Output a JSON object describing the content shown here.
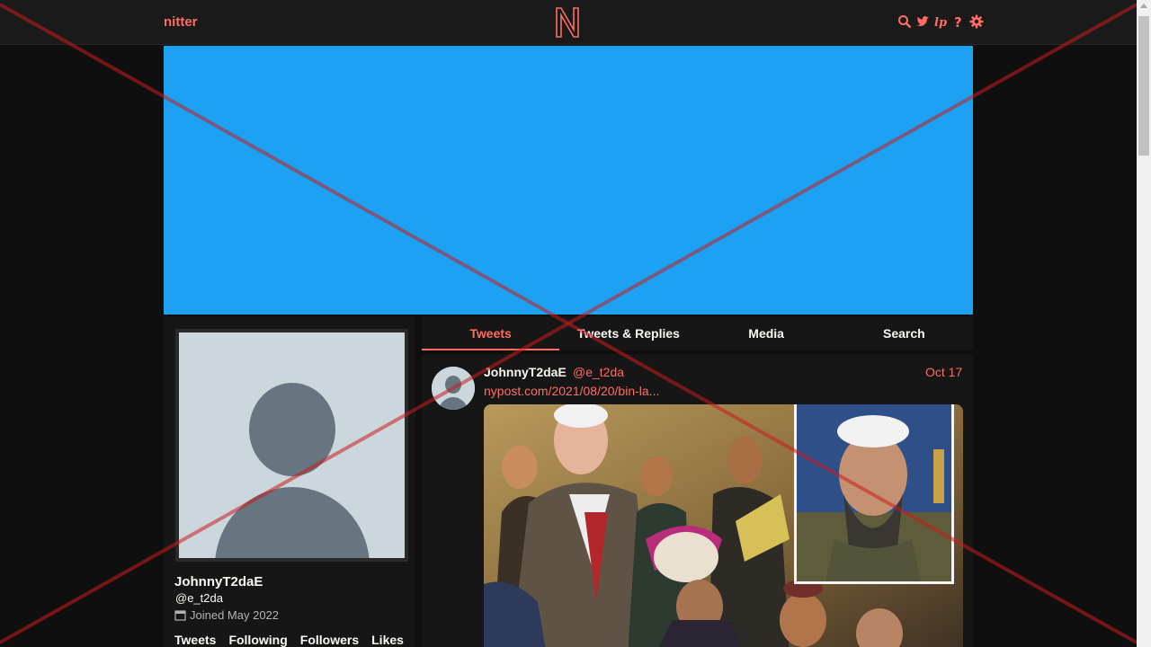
{
  "nav": {
    "brand": "nitter",
    "logo_letter": "N",
    "icons": [
      "search-icon",
      "twitter-bird-icon",
      "liberapay-icon",
      "help-icon",
      "settings-gear-icon"
    ]
  },
  "colors": {
    "accent": "#ff6c60",
    "banner": "#1da1f2",
    "background": "#0f0f0f",
    "panel": "#161616",
    "placeholder_avatar": "#ccd6dd",
    "placeholder_figure": "#66757f",
    "overlay_cross": "#c81e1e"
  },
  "profile": {
    "fullname": "JohnnyT2daE",
    "username": "@e_t2da",
    "joined": "Joined May 2022",
    "stats": [
      "Tweets",
      "Following",
      "Followers",
      "Likes"
    ]
  },
  "tabs": [
    {
      "label": "Tweets",
      "active": true
    },
    {
      "label": "Tweets & Replies",
      "active": false
    },
    {
      "label": "Media",
      "active": false
    },
    {
      "label": "Search",
      "active": false
    }
  ],
  "tweet": {
    "fullname": "JohnnyT2daE",
    "username": "@e_t2da",
    "date": "Oct 17",
    "link_text": "nypost.com/2021/08/20/bin-la..."
  }
}
